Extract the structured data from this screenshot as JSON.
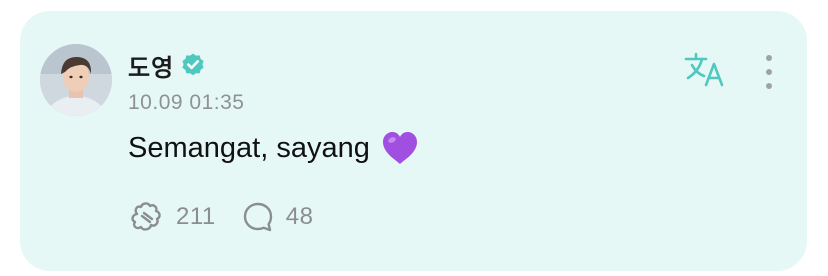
{
  "post": {
    "author": "도영",
    "timestamp": "10.09 01:35",
    "message": "Semangat, sayang",
    "emoji": "purple-heart-emoji"
  },
  "stats": {
    "likes": "211",
    "comments": "48"
  },
  "icons": {
    "verified": "verified-badge-icon",
    "translate": "translate-icon",
    "more": "more-vertical-icon",
    "like": "paw-like-icon",
    "comment": "comment-bubble-icon"
  },
  "colors": {
    "card_background": "#e6f8f6",
    "accent": "#4fc9c0",
    "heart": "#a04fe0",
    "muted_text": "#8e9294"
  }
}
